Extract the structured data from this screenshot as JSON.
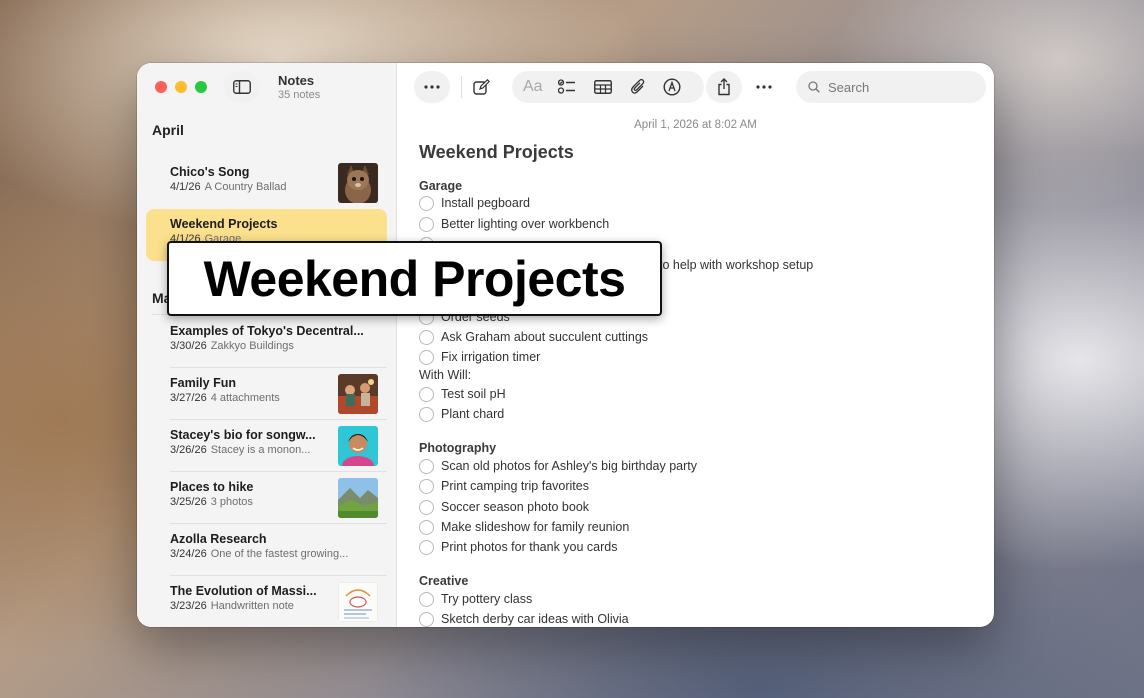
{
  "app": {
    "title": "Notes",
    "subtitle": "35 notes"
  },
  "search": {
    "placeholder": "Search"
  },
  "toolbar": {
    "format_label": "Aa"
  },
  "sidebar": {
    "sections": [
      {
        "title": "April"
      },
      {
        "title": "Ma"
      }
    ],
    "notes": [
      {
        "title": "Chico's Song",
        "date": "4/1/26",
        "preview": "A Country Ballad",
        "thumb": "cat-photo"
      },
      {
        "title": "Weekend Projects",
        "date": "4/1/26",
        "preview": "Garage",
        "selected": true
      },
      {
        "title": "Examples of Tokyo's Decentral...",
        "date": "3/30/26",
        "preview": "Zakkyo Buildings"
      },
      {
        "title": "Family Fun",
        "date": "3/27/26",
        "preview": "4 attachments",
        "thumb": "family-photo"
      },
      {
        "title": "Stacey's bio for songw...",
        "date": "3/26/26",
        "preview": "Stacey is a monon...",
        "thumb": "portrait-photo"
      },
      {
        "title": "Places to hike",
        "date": "3/25/26",
        "preview": "3 photos",
        "thumb": "landscape-photo"
      },
      {
        "title": "Azolla Research",
        "date": "3/24/26",
        "preview": "One of the fastest growing..."
      },
      {
        "title": "The Evolution of Massi...",
        "date": "3/23/26",
        "preview": "Handwritten note",
        "thumb": "handwritten-note"
      }
    ]
  },
  "editor": {
    "date": "April 1, 2026 at 8:02 AM",
    "heading": "Weekend Projects",
    "groups": [
      {
        "title": "Garage",
        "items": [
          "Install pegboard",
          "Better lighting over workbench",
          "",
          "to help with workshop setup"
        ]
      },
      {
        "title": "",
        "items": [
          "Order seeds",
          "Ask Graham about succulent cuttings",
          "Fix irrigation timer"
        ]
      },
      {
        "title": "With Will:",
        "items": [
          "Test soil pH",
          "Plant chard"
        ]
      },
      {
        "title": "Photography",
        "items": [
          "Scan old photos for Ashley's big birthday party",
          "Print camping trip favorites",
          "Soccer season photo book",
          "Make slideshow for family reunion",
          "Print photos for thank you cards"
        ]
      },
      {
        "title": "Creative",
        "items": [
          "Try pottery class",
          "Sketch derby car ideas with Olivia"
        ]
      }
    ]
  },
  "callout": {
    "text": "Weekend Projects"
  },
  "colors": {
    "selected_note": "#fbe08d",
    "close": "#fe5f57",
    "minimize": "#febc2e",
    "zoom": "#28c840"
  }
}
